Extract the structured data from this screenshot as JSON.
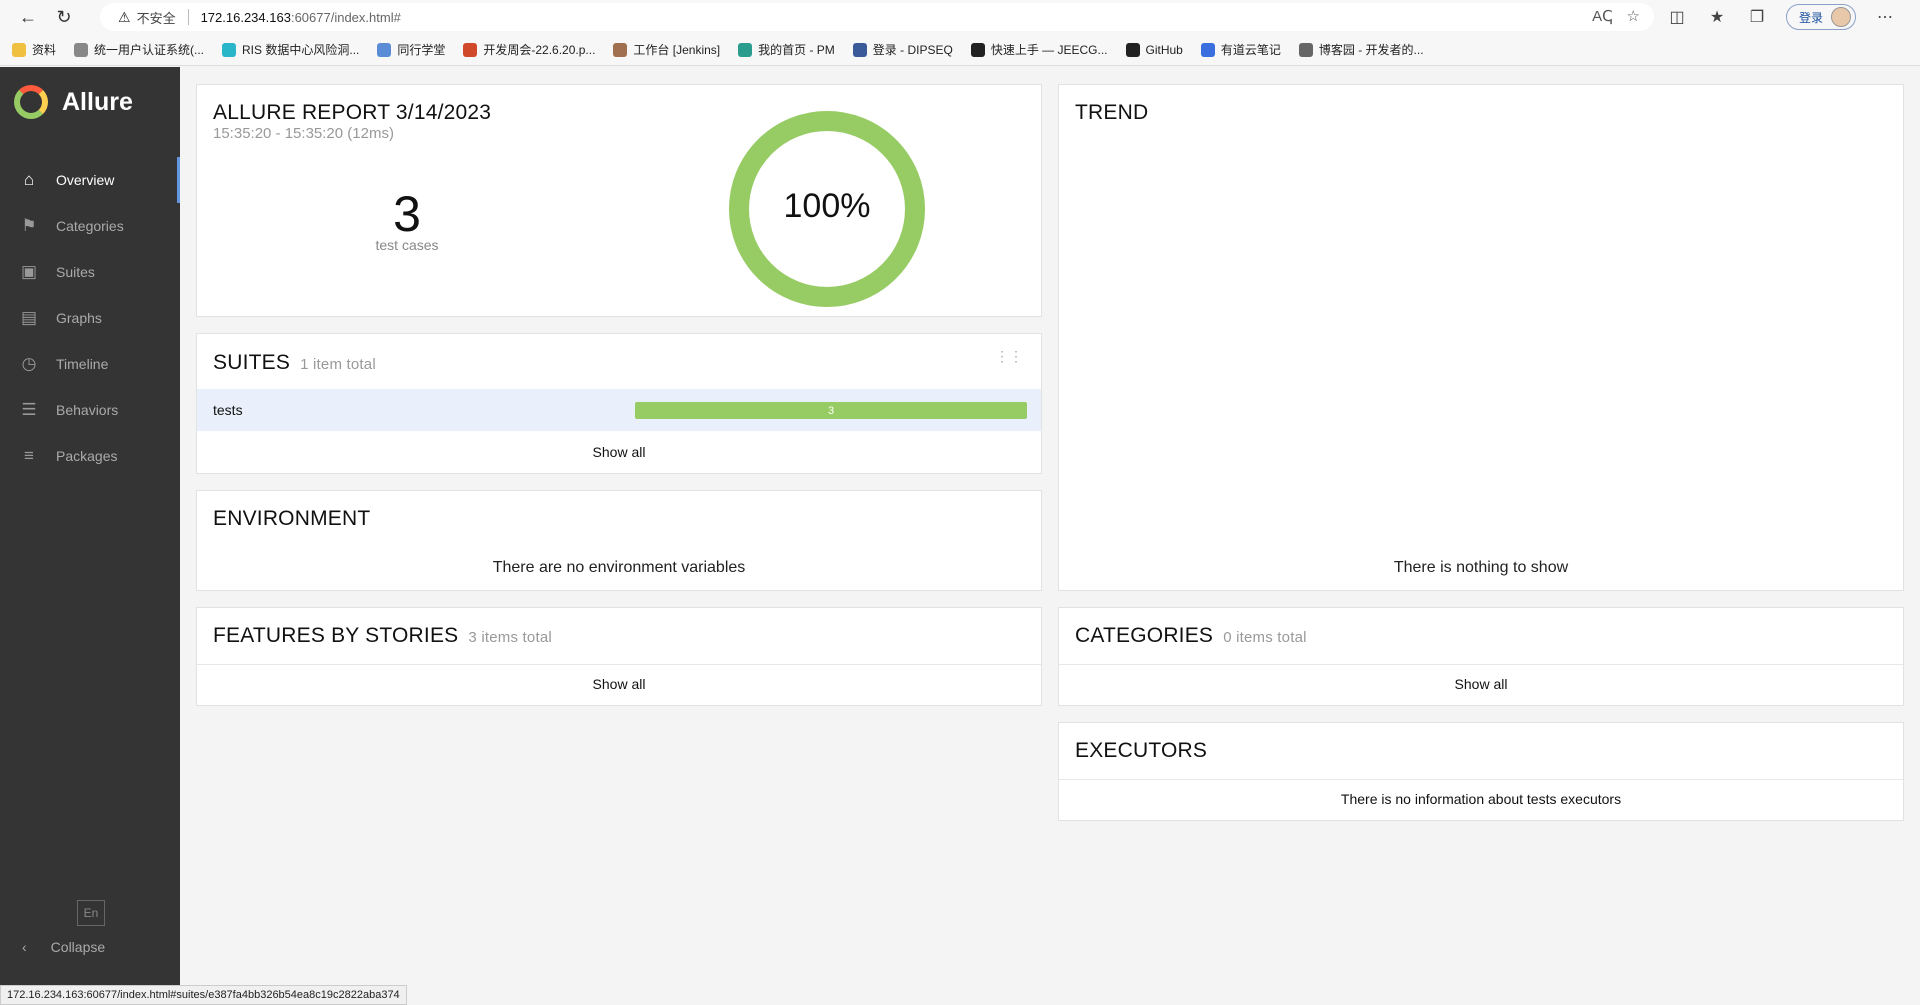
{
  "browser": {
    "security_label": "不安全",
    "url_host": "172.16.234.163",
    "url_path": ":60677/index.html#",
    "login_label": "登录",
    "bookmarks": [
      "资料",
      "统一用户认证系统(...",
      "RIS 数据中心风险洞...",
      "同行学堂",
      "开发周会-22.6.20.p...",
      "工作台 [Jenkins]",
      "我的首页 - PM",
      "登录 - DIPSEQ",
      "快速上手 — JEECG...",
      "GitHub",
      "有道云笔记",
      "博客园 - 开发者的..."
    ],
    "status_url": "172.16.234.163:60677/index.html#suites/e387fa4bb326b54ea8c19c2822aba374"
  },
  "sidebar": {
    "brand": "Allure",
    "items": [
      {
        "label": "Overview",
        "icon": "home-icon"
      },
      {
        "label": "Categories",
        "icon": "flag-icon"
      },
      {
        "label": "Suites",
        "icon": "briefcase-icon"
      },
      {
        "label": "Graphs",
        "icon": "bar-chart-icon"
      },
      {
        "label": "Timeline",
        "icon": "clock-icon"
      },
      {
        "label": "Behaviors",
        "icon": "list-icon"
      },
      {
        "label": "Packages",
        "icon": "align-left-icon"
      }
    ],
    "language": "En",
    "collapse_label": "Collapse"
  },
  "summary": {
    "title": "ALLURE REPORT 3/14/2023",
    "time_range": "15:35:20 - 15:35:20 (12ms)",
    "test_count": "3",
    "test_count_label": "test cases",
    "percent_label": "100%",
    "passed_fraction": 1.0,
    "ring_color": "#97cc64"
  },
  "trend": {
    "title": "TREND",
    "empty_text": "There is nothing to show"
  },
  "suites": {
    "title": "SUITES",
    "subtitle": "1 item total",
    "rows": [
      {
        "name": "tests",
        "passed": "3",
        "passed_fraction": 1.0
      }
    ],
    "show_all": "Show all"
  },
  "environment": {
    "title": "ENVIRONMENT",
    "empty_text": "There are no environment variables"
  },
  "features": {
    "title": "FEATURES BY STORIES",
    "subtitle": "3 items total",
    "show_all": "Show all"
  },
  "categories": {
    "title": "CATEGORIES",
    "subtitle": "0 items total",
    "show_all": "Show all"
  },
  "executors": {
    "title": "EXECUTORS",
    "empty_text": "There is no information about tests executors"
  }
}
